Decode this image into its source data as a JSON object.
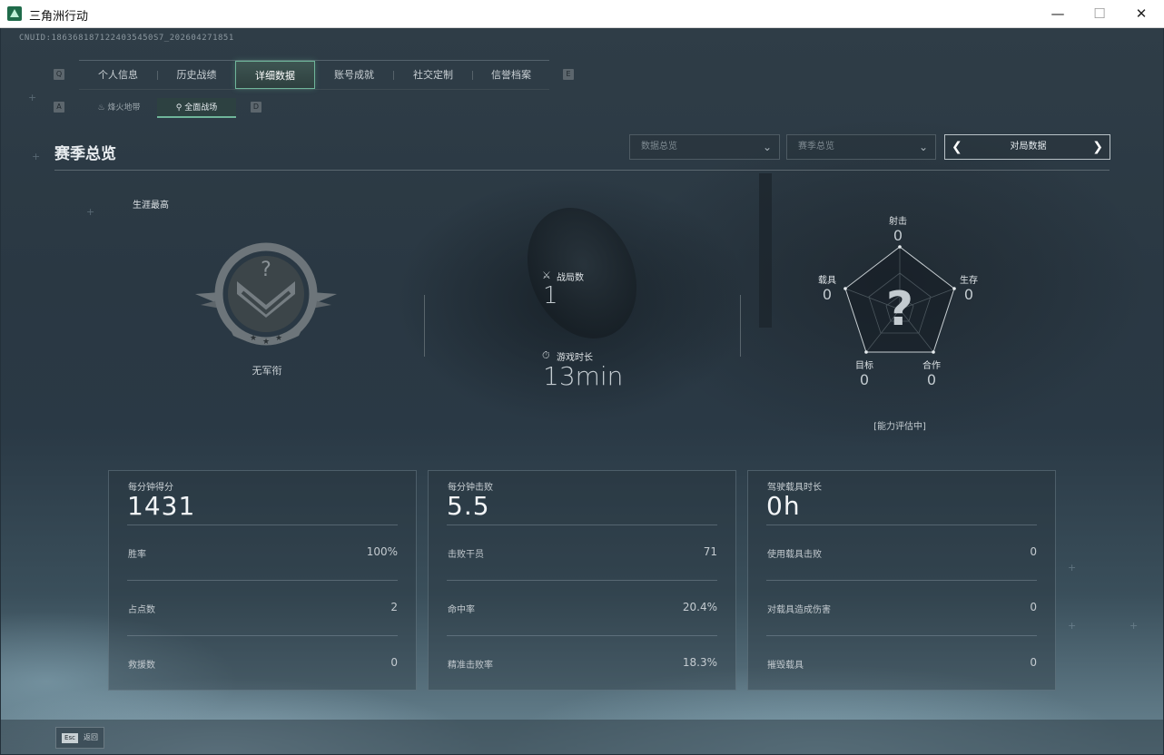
{
  "window": {
    "title": "三角洲行动",
    "min": "—",
    "max": "☐",
    "close": "✕"
  },
  "uid": "CNUID:1863681871224035450S7_202604271851",
  "nav": {
    "left_key": "Q",
    "right_key": "E",
    "tabs": [
      {
        "label": "个人信息",
        "active": false
      },
      {
        "label": "历史战绩",
        "active": false
      },
      {
        "label": "详细数据",
        "active": true
      },
      {
        "label": "账号成就",
        "active": false
      },
      {
        "label": "社交定制",
        "active": false
      },
      {
        "label": "信誉档案",
        "active": false
      }
    ]
  },
  "subnav": {
    "left_key": "A",
    "right_key": "D",
    "tabs": [
      {
        "label": "烽火地带",
        "icon": "flame-icon",
        "active": false
      },
      {
        "label": "全面战场",
        "icon": "battlefield-icon",
        "active": true
      }
    ]
  },
  "section": {
    "title": "赛季总览",
    "dropdown1": "数据总览",
    "dropdown2": "赛季总览",
    "pager_label": "对局数据"
  },
  "career": {
    "label": "生涯最高",
    "rank_name": "无军衔",
    "rank_mark": "?"
  },
  "stats": {
    "matches_label": "战局数",
    "matches_value": "1",
    "time_label": "游戏时长",
    "time_value": "13min"
  },
  "radar": {
    "mark": "?",
    "status": "[能力评估中]",
    "axes": [
      {
        "label": "射击",
        "value": "0"
      },
      {
        "label": "生存",
        "value": "0"
      },
      {
        "label": "合作",
        "value": "0"
      },
      {
        "label": "目标",
        "value": "0"
      },
      {
        "label": "载具",
        "value": "0"
      }
    ]
  },
  "cards": [
    {
      "title": "每分钟得分",
      "main": "1431",
      "rows": [
        {
          "label": "胜率",
          "value": "100%"
        },
        {
          "label": "占点数",
          "value": "2"
        },
        {
          "label": "救援数",
          "value": "0"
        }
      ]
    },
    {
      "title": "每分钟击败",
      "main": "5.5",
      "rows": [
        {
          "label": "击败干员",
          "value": "71"
        },
        {
          "label": "命中率",
          "value": "20.4%"
        },
        {
          "label": "精准击败率",
          "value": "18.3%"
        }
      ]
    },
    {
      "title": "驾驶载具时长",
      "main": "0h",
      "rows": [
        {
          "label": "使用载具击败",
          "value": "0"
        },
        {
          "label": "对载具造成伤害",
          "value": "0"
        },
        {
          "label": "摧毁载具",
          "value": "0"
        }
      ]
    }
  ],
  "footer": {
    "esc_key": "Esc",
    "esc_label": "返回"
  }
}
